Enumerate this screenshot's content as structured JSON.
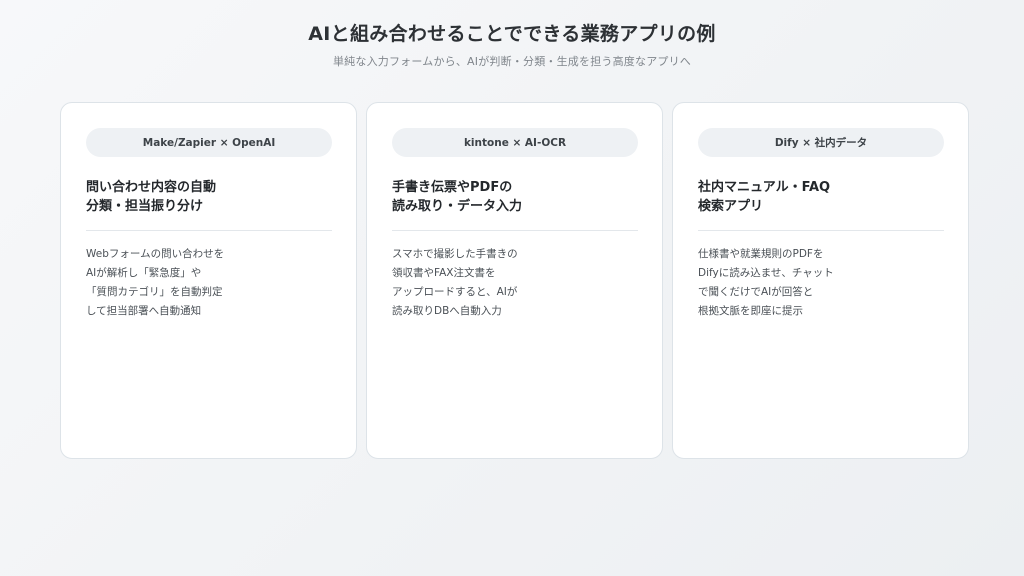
{
  "header": {
    "title": "AIと組み合わせることでできる業務アプリの例",
    "subtitle": "単純な入力フォームから、AIが判断・分類・生成を担う高度なアプリへ"
  },
  "cards": [
    {
      "badge": "Make/Zapier × OpenAI",
      "title_lines": [
        "問い合わせ内容の自動",
        "分類・担当振り分け"
      ],
      "description_lines": [
        "Webフォームの問い合わせを",
        "AIが解析し「緊急度」や",
        "「質問カテゴリ」を自動判定",
        "して担当部署へ自動通知"
      ]
    },
    {
      "badge": "kintone × AI-OCR",
      "title_lines": [
        "手書き伝票やPDFの",
        "読み取り・データ入力"
      ],
      "description_lines": [
        "スマホで撮影した手書きの",
        "領収書やFAX注文書を",
        "アップロードすると、AIが",
        "読み取りDBへ自動入力"
      ]
    },
    {
      "badge": "Dify × 社内データ",
      "title_lines": [
        "社内マニュアル・FAQ",
        "検索アプリ"
      ],
      "description_lines": [
        "仕様書や就業規則のPDFを",
        "Difyに読み込ませ、チャット",
        "で聞くだけでAIが回答と",
        "根拠文脈を即座に提示"
      ]
    }
  ]
}
